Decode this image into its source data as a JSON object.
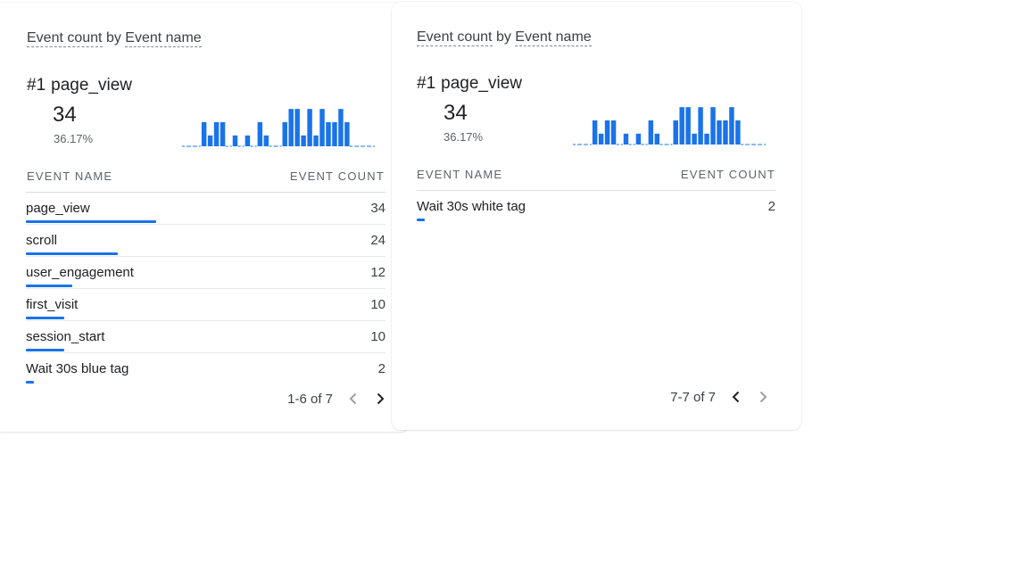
{
  "colors": {
    "accent": "#1a73e8",
    "text": "#202124",
    "muted": "#5f6368"
  },
  "cards": [
    {
      "title_prefix": "Event count",
      "title_by": " by ",
      "title_dim": "Event name",
      "top_rank": "#1",
      "top_name": "page_view",
      "top_value": "34",
      "top_pct": "36.17%",
      "sparkline": [
        0,
        0,
        0,
        1,
        0.45,
        1,
        1,
        0,
        0.45,
        0,
        0.45,
        0,
        1,
        0.45,
        0,
        0,
        1,
        1.55,
        1.55,
        0.45,
        1.55,
        0.45,
        1.55,
        1,
        1,
        1.55,
        1,
        0,
        0,
        0,
        0
      ],
      "col_name": "EVENT NAME",
      "col_count": "EVENT COUNT",
      "rows": [
        {
          "name": "page_view",
          "count": "34",
          "value": 34
        },
        {
          "name": "scroll",
          "count": "24",
          "value": 24
        },
        {
          "name": "user_engagement",
          "count": "12",
          "value": 12
        },
        {
          "name": "first_visit",
          "count": "10",
          "value": 10
        },
        {
          "name": "session_start",
          "count": "10",
          "value": 10
        },
        {
          "name": "Wait 30s blue tag",
          "count": "2",
          "value": 2
        }
      ],
      "pagination": "1-6 of 7",
      "prev_enabled": false,
      "next_enabled": true
    },
    {
      "title_prefix": "Event count",
      "title_by": " by ",
      "title_dim": "Event name",
      "top_rank": "#1",
      "top_name": "page_view",
      "top_value": "34",
      "top_pct": "36.17%",
      "sparkline": [
        0,
        0,
        0,
        1,
        0.45,
        1,
        1,
        0,
        0.45,
        0,
        0.45,
        0,
        1,
        0.45,
        0,
        0,
        1,
        1.55,
        1.55,
        0.45,
        1.55,
        0.45,
        1.55,
        1,
        1,
        1.55,
        1,
        0,
        0,
        0,
        0
      ],
      "col_name": "EVENT NAME",
      "col_count": "EVENT COUNT",
      "rows": [
        {
          "name": "Wait 30s white tag",
          "count": "2",
          "value": 2
        }
      ],
      "pagination": "7-7 of 7",
      "prev_enabled": true,
      "next_enabled": false
    }
  ],
  "bar_scale_max": 34
}
